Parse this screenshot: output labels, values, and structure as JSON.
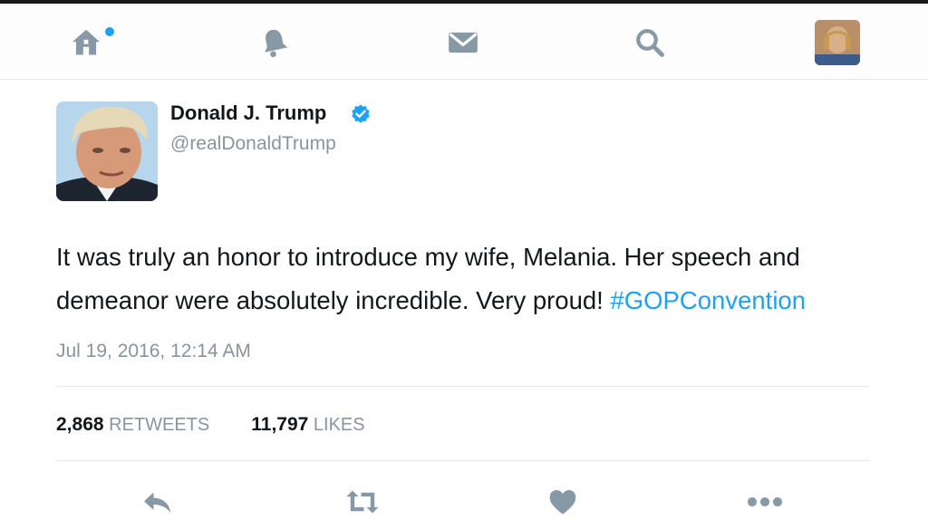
{
  "nav": {
    "home_icon": "home-icon",
    "notifications_icon": "bell-icon",
    "messages_icon": "envelope-icon",
    "search_icon": "search-icon",
    "accent_color": "#1da1f2"
  },
  "tweet": {
    "author_name": "Donald J. Trump",
    "handle": "@realDonaldTrump",
    "verified": true,
    "text_plain": "It was truly an honor to introduce my wife, Melania. Her speech and demeanor were absolutely incredible. Very proud! ",
    "hashtag": "#GOPConvention",
    "timestamp": "Jul 19, 2016, 12:14 AM",
    "retweets_count": "2,868",
    "retweets_label": "RETWEETS",
    "likes_count": "11,797",
    "likes_label": "LIKES"
  },
  "actions": [
    "reply-icon",
    "retweet-icon",
    "like-icon",
    "more-icon"
  ]
}
